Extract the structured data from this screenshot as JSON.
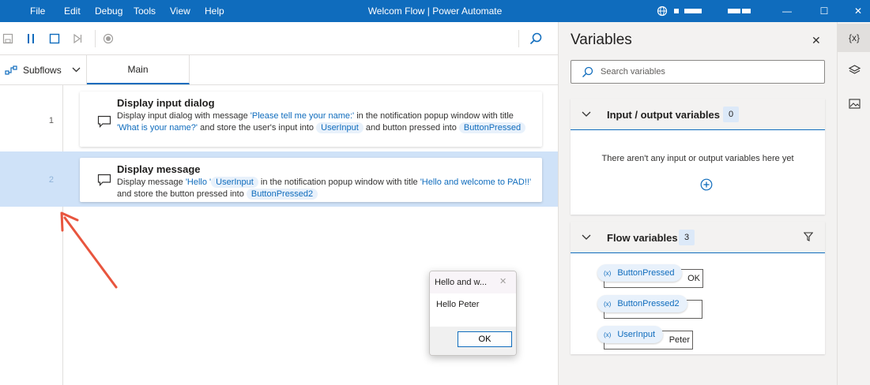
{
  "titlebar": {
    "menu": [
      "File",
      "Edit",
      "Debug",
      "Tools",
      "View",
      "Help"
    ],
    "title": "Welcom Flow | Power Automate",
    "minimize_glyph": "—",
    "maximize_glyph": "☐",
    "close_glyph": "✕"
  },
  "toolbar": {
    "icons": [
      "save-icon",
      "pause-icon",
      "stop-icon",
      "next-step-icon",
      "record-icon",
      "search-icon"
    ]
  },
  "tabs": {
    "subflows_label": "Subflows",
    "main_label": "Main"
  },
  "steps": [
    {
      "number": "1",
      "title": "Display input dialog",
      "desc": {
        "p1": "Display input dialog with message ",
        "l1": "'Please tell me your name:'",
        "p2": " in the notification popup window with title ",
        "l2": "'What is your name?'",
        "p3": " and store the user's input into ",
        "v1": "UserInput",
        "p4": " and button pressed into ",
        "v2": "ButtonPressed"
      }
    },
    {
      "number": "2",
      "title": "Display message",
      "desc": {
        "p1": "Display message ",
        "l1": "'Hello '",
        "v1": "UserInput",
        "p2": " in the notification popup window with title ",
        "l2": "'Hello and welcome to PAD!!'",
        "p3": " and store the button pressed into ",
        "v2": "ButtonPressed2"
      }
    }
  ],
  "dialog": {
    "title": "Hello and w...",
    "close_glyph": "✕",
    "message": "Hello Peter",
    "ok_label": "OK"
  },
  "variables": {
    "title": "Variables",
    "close_glyph": "✕",
    "search_placeholder": "Search variables",
    "io_section": {
      "title": "Input / output variables",
      "count": "0",
      "empty_text": "There aren't any input or output variables here yet"
    },
    "flow_section": {
      "title": "Flow variables",
      "count": "3",
      "items": [
        {
          "icon_text": "(x)",
          "name": "ButtonPressed",
          "value": "OK"
        },
        {
          "icon_text": "(x)",
          "name": "ButtonPressed2",
          "value": ""
        },
        {
          "icon_text": "(x)",
          "name": "UserInput",
          "value": "Peter"
        }
      ]
    }
  },
  "rail": {
    "variables_label": "{x}"
  },
  "colors": {
    "accent": "#0f6cbd",
    "annotation_arrow": "#e8553e"
  }
}
